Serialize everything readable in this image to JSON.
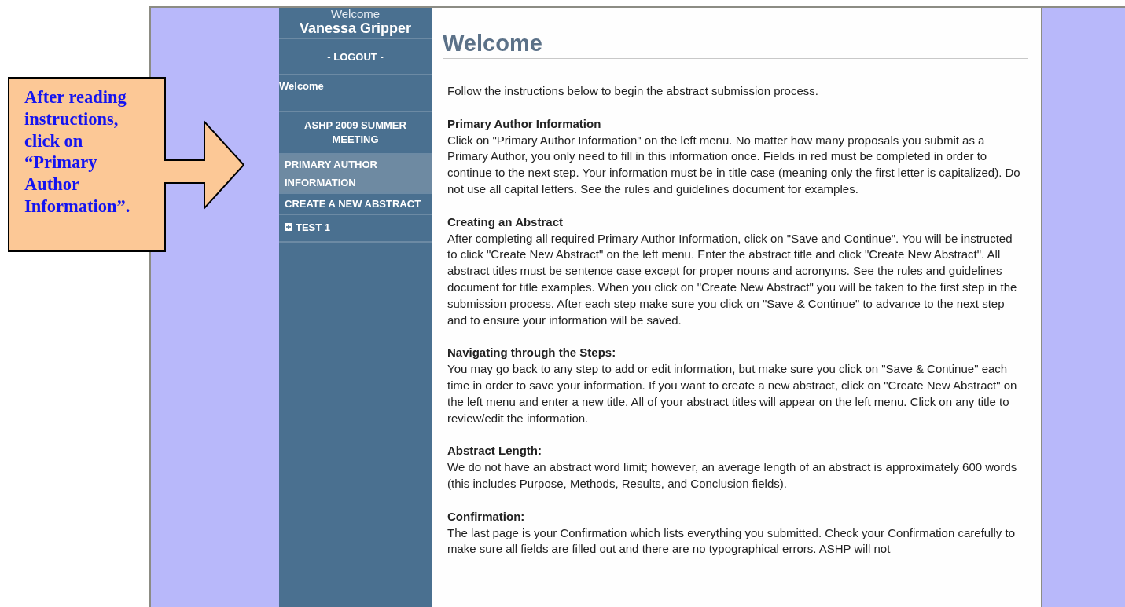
{
  "sidebar": {
    "welcome_label": "Welcome",
    "user_name": "Vanessa Gripper",
    "logout": "- LOGOUT -",
    "items": [
      {
        "kind": "link",
        "label": "Welcome",
        "selected": false
      },
      {
        "kind": "heading",
        "label": "ASHP 2009 SUMMER MEETING",
        "selected": false
      },
      {
        "kind": "link",
        "label": "PRIMARY AUTHOR INFORMATION",
        "selected": true
      },
      {
        "kind": "link",
        "label": "CREATE A NEW ABSTRACT",
        "selected": false
      },
      {
        "kind": "tree",
        "label": "TEST 1",
        "selected": false,
        "expanded": false
      }
    ]
  },
  "content": {
    "title": "Welcome",
    "intro": "Follow the instructions below to begin the abstract submission process.",
    "sections": [
      {
        "heading": "Primary Author Information",
        "text": "Click on \"Primary Author Information\" on the left menu. No matter how many proposals you submit as a Primary Author, you only need to fill in this information once. Fields in red must be completed in order to continue to the next step. Your information must be in title case (meaning only the first letter is capitalized). Do not use all capital letters. See the rules and guidelines document for examples."
      },
      {
        "heading": "Creating an Abstract",
        "text": "After completing all required Primary Author Information, click on \"Save and Continue\". You will be instructed to click \"Create New Abstract\" on the left menu. Enter the abstract title and click \"Create New Abstract\". All abstract titles must be sentence case except for proper nouns and acronyms. See the rules and guidelines document for title examples. When you click on \"Create New Abstract\" you will be taken to the first step in the submission process. After each step make sure you click on \"Save & Continue\" to advance to the next step and to ensure your information will be saved."
      },
      {
        "heading": "Navigating through the Steps:",
        "text": "You may go back to any step to add or edit information, but make sure you click on \"Save & Continue\" each time in order to save your information. If you want to create a new abstract, click on \"Create New Abstract\" on the left menu and enter a new title. All of your abstract titles will appear on the left menu. Click on any title to review/edit the information."
      },
      {
        "heading": "Abstract Length:",
        "text": "We do not have an abstract word limit; however, an average length of an abstract is approximately 600 words (this includes Purpose, Methods, Results, and Conclusion fields)."
      },
      {
        "heading": "Confirmation:",
        "text": "The last page is your Confirmation which lists everything you submitted. Check your Confirmation carefully to make sure all fields are filled out and there are no typographical errors. ASHP will not"
      }
    ]
  },
  "callout": {
    "text": "After reading instructions, click on “Primary Author Information”."
  }
}
